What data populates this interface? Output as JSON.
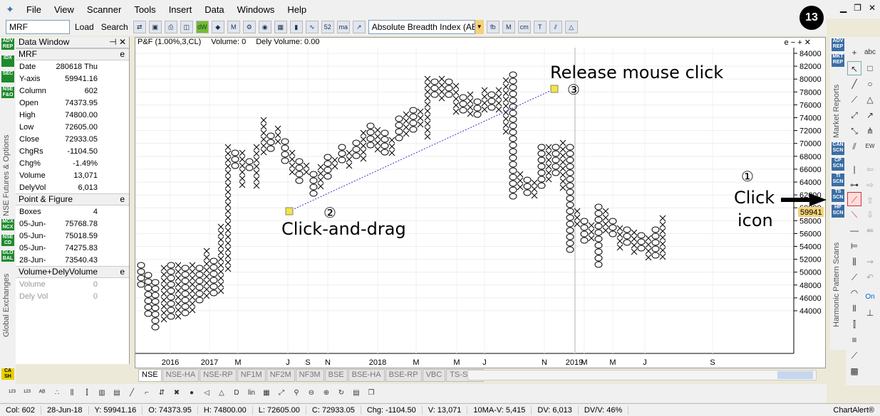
{
  "menu": [
    "File",
    "View",
    "Scanner",
    "Tools",
    "Insert",
    "Data",
    "Windows",
    "Help"
  ],
  "badge": "13",
  "toolbar": {
    "symbol": "MRF",
    "load": "Load",
    "search": "Search",
    "indicator": "Absolute Breadth Index (ABI"
  },
  "data_window": {
    "title": "Data Window",
    "section1": "MRF",
    "rows": [
      [
        "Date",
        "280618 Thu"
      ],
      [
        "Y-axis",
        "59941.16"
      ],
      [
        "Column",
        "602"
      ],
      [
        "Open",
        "74373.95"
      ],
      [
        "High",
        "74800.00"
      ],
      [
        "Low",
        "72605.00"
      ],
      [
        "Close",
        "72933.05"
      ],
      [
        "ChgRs",
        "-1104.50"
      ],
      [
        "Chg%",
        "-1.49%"
      ],
      [
        "Volume",
        "13,071"
      ],
      [
        "DelyVol",
        "6,013"
      ]
    ],
    "section2": "Point & Figure",
    "pf_rows": [
      [
        "Boxes",
        "4"
      ],
      [
        "05-Jun-",
        "75768.78"
      ],
      [
        "05-Jun-",
        "75018.59"
      ],
      [
        "05-Jun-",
        "74275.83"
      ],
      [
        "28-Jun-",
        "73540.43"
      ]
    ],
    "section3": "Volume+DelyVolume",
    "vol_rows": [
      [
        "Volume",
        "0"
      ],
      [
        "Dely Vol",
        "0"
      ]
    ]
  },
  "left_labels": [
    "NSE Futures & Options",
    "Global Exchanges"
  ],
  "left_buttons": [
    "ADV REP",
    "IDX",
    "SEC",
    "NSE F&O",
    "MCX NCX",
    "NSE CD",
    "GLO BAL",
    "CA SH"
  ],
  "chart": {
    "header": [
      "P&F (1.00%,3,CL)",
      "Volume: 0",
      "Dely Volume: 0.00"
    ],
    "y_ticks": [
      "84000",
      "82000",
      "80000",
      "78000",
      "76000",
      "74000",
      "72000",
      "70000",
      "68000",
      "66000",
      "64000",
      "62000",
      "60000",
      "58000",
      "56000",
      "54000",
      "52000",
      "50000",
      "48000",
      "46000",
      "44000"
    ],
    "price_tag": "59941",
    "x_ticks": [
      "2016",
      "2017",
      "M",
      "J",
      "S",
      "N",
      "2018",
      "M",
      "M",
      "J",
      "N",
      "2019",
      "M",
      "M",
      "J",
      "S"
    ]
  },
  "annotations": {
    "step1_num": "①",
    "step1a": "Click",
    "step1b": "icon",
    "step2_num": "②",
    "step2": "Click-and-drag",
    "step3": "Release mouse click",
    "step3_num": "③"
  },
  "tabs": [
    "NSE",
    "NSE-HA",
    "NSE-RP",
    "NF1M",
    "NF2M",
    "NF3M",
    "BSE",
    "BSE-HA",
    "BSE-RP",
    "VBC",
    "TS-Stats"
  ],
  "right_labels": [
    "Market Reports",
    "Harmonic Pattern Scans"
  ],
  "right_buttons": [
    "ADV REP",
    "MKT REP",
    "CAN SCN",
    "CP SCN",
    "TI SCN",
    "TS SCN",
    "HP SCN"
  ],
  "status": [
    "Col: 602",
    "28-Jun-18",
    "Y: 59941.16",
    "O: 74373.95",
    "H: 74800.00",
    "L: 72605.00",
    "C: 72933.05",
    "Chg: -1104.50",
    "V: 13,071",
    "10MA-V: 5,415",
    "DV: 6,013",
    "DV/V: 46%",
    "ChartAlert®"
  ]
}
